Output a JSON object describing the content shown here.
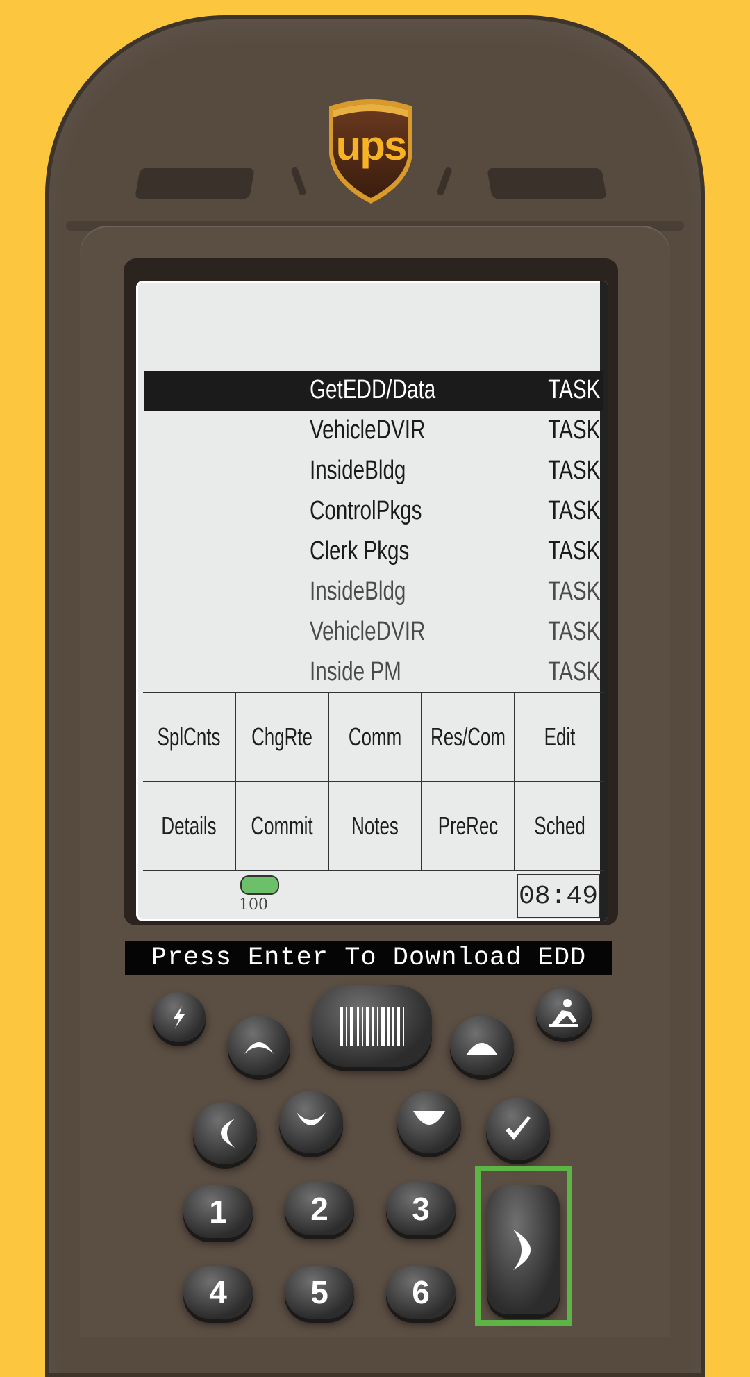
{
  "brand": {
    "logo_text": "ups"
  },
  "tasks": [
    {
      "name": "GetEDD/Data",
      "tag": "TASK",
      "selected": true
    },
    {
      "name": "VehicleDVIR",
      "tag": "TASK"
    },
    {
      "name": "InsideBldg",
      "tag": "TASK"
    },
    {
      "name": "ControlPkgs",
      "tag": "TASK"
    },
    {
      "name": "Clerk Pkgs",
      "tag": "TASK"
    },
    {
      "name": "InsideBldg",
      "tag": "TASK"
    },
    {
      "name": "VehicleDVIR",
      "tag": "TASK"
    },
    {
      "name": "Inside PM",
      "tag": "TASK"
    }
  ],
  "softkeys": {
    "row1": [
      "SplCnts",
      "ChgRte",
      "Comm",
      "Res/Com",
      "Edit"
    ],
    "row2": [
      "Details",
      "Commit",
      "Notes",
      "PreRec",
      "Sched"
    ]
  },
  "status": {
    "battery_percent": "100",
    "time": "08:49"
  },
  "message": "Press Enter To Download EDD",
  "keypad": {
    "numbers": [
      "1",
      "2",
      "3",
      "4",
      "5",
      "6"
    ]
  },
  "colors": {
    "background": "#fcc63f",
    "device": "#574b40",
    "highlight": "#5cb545",
    "battery": "#6cc06a"
  },
  "icons": [
    "power-icon",
    "barcode-scan-icon",
    "person-icon",
    "up-arrow-icon",
    "down-arrow-icon",
    "left-arrow-icon",
    "check-icon",
    "enter-icon"
  ]
}
